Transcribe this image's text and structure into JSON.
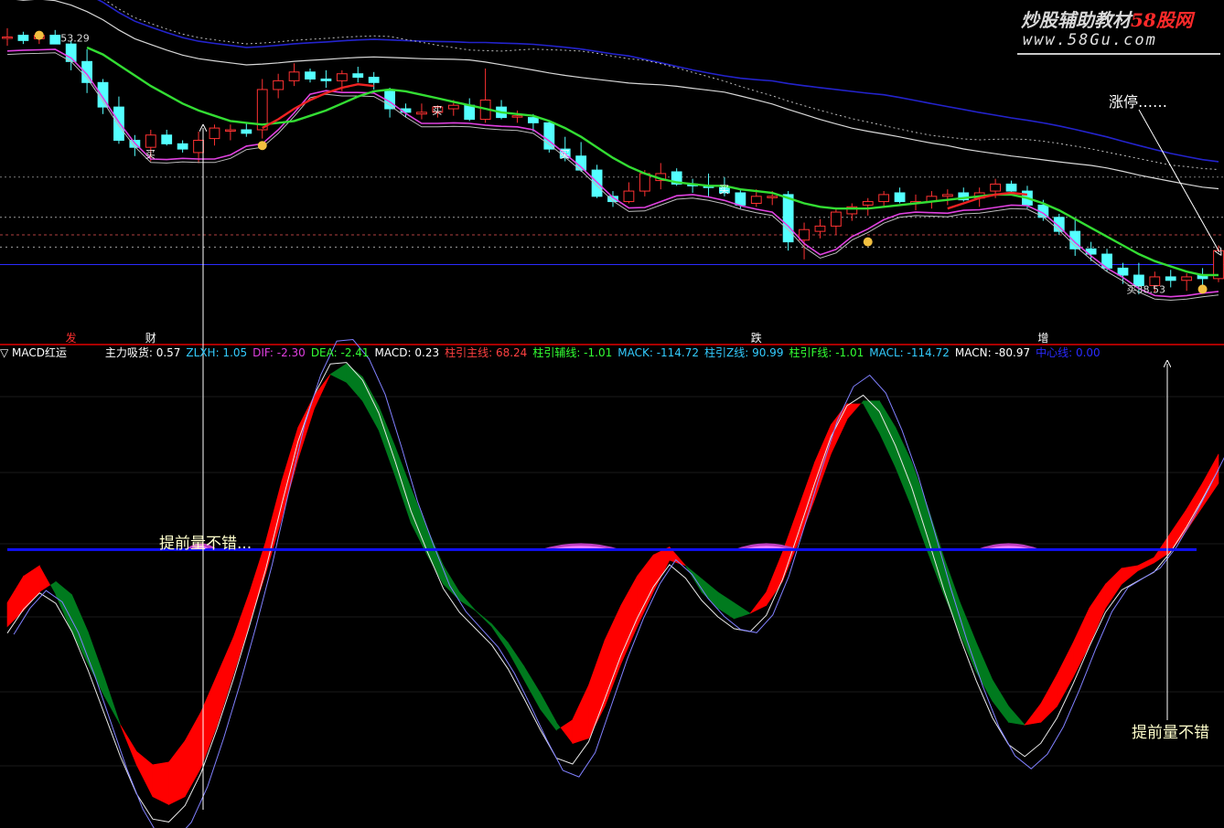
{
  "watermark": {
    "line1_a": "炒股辅助教材",
    "line1_b": "58股网",
    "line2": "www.58Gu.com"
  },
  "price_panel": {
    "high_label": "53.29",
    "low_label": "38.53",
    "buy_mark": "买",
    "zhangting_note": "涨停……",
    "bottom_labels": [
      {
        "text": "发",
        "color": "#ff3030"
      },
      {
        "text": "财",
        "color": "#ffffff"
      },
      {
        "text": "跌",
        "color": "#ffffff"
      },
      {
        "text": "增",
        "color": "#ffffff"
      }
    ]
  },
  "indicator_bar": {
    "title": "▽ MACD红运",
    "items": [
      {
        "label": "主力吸货: 0.57",
        "color": "#ffffff"
      },
      {
        "label": "ZLXH: 1.05",
        "color": "#33ccff"
      },
      {
        "label": "DIF: -2.30",
        "color": "#e040e0"
      },
      {
        "label": "DEA: -2.41",
        "color": "#33ff33"
      },
      {
        "label": "MACD: 0.23",
        "color": "#ffffff"
      },
      {
        "label": "柱引主线: 68.24",
        "color": "#ff4040"
      },
      {
        "label": "柱引辅线: -1.01",
        "color": "#33ff33"
      },
      {
        "label": "MACK: -114.72",
        "color": "#33ccff"
      },
      {
        "label": "柱引Z线: 90.99",
        "color": "#33ccff"
      },
      {
        "label": "柱引F线: -1.01",
        "color": "#33ff33"
      },
      {
        "label": "MACL: -114.72",
        "color": "#33ccff"
      },
      {
        "label": "MACN: -80.97",
        "color": "#ffffff"
      },
      {
        "label": "中心线: 0.00",
        "color": "#2a2aff"
      }
    ]
  },
  "annotations": {
    "left_note": "提前量不错...",
    "right_note": "提前量不错"
  },
  "colors": {
    "up_candle": "#ff3232",
    "down_candle": "#54ffff",
    "ma_green": "#33dd33",
    "ma_red": "#ee2222",
    "ma_magenta": "#e040e0",
    "ma_blue": "#2222dd",
    "band_red": "#ff0000",
    "band_green": "#007a1e",
    "zero_line": "#1010ff",
    "note": "#ffffcc"
  },
  "chart_data": [
    {
      "type": "candlestick",
      "title": "",
      "ylim": [
        36,
        55
      ],
      "y_labels_shown": [
        53.29,
        38.53
      ],
      "candles": [
        {
          "o": 53.2,
          "h": 53.7,
          "l": 52.7,
          "c": 53.2
        },
        {
          "o": 53.3,
          "h": 53.5,
          "l": 52.8,
          "c": 53.0
        },
        {
          "o": 53.1,
          "h": 53.3,
          "l": 52.8,
          "c": 53.3
        },
        {
          "o": 53.3,
          "h": 53.6,
          "l": 52.8,
          "c": 52.8
        },
        {
          "o": 52.8,
          "h": 53.0,
          "l": 51.3,
          "c": 51.8
        },
        {
          "o": 51.8,
          "h": 52.5,
          "l": 50.0,
          "c": 50.6
        },
        {
          "o": 50.6,
          "h": 50.8,
          "l": 48.8,
          "c": 49.2
        },
        {
          "o": 49.2,
          "h": 49.8,
          "l": 47.1,
          "c": 47.3
        },
        {
          "o": 47.3,
          "h": 47.6,
          "l": 46.4,
          "c": 46.9
        },
        {
          "o": 46.9,
          "h": 47.9,
          "l": 46.1,
          "c": 47.6
        },
        {
          "o": 47.6,
          "h": 47.9,
          "l": 47.0,
          "c": 47.1
        },
        {
          "o": 47.1,
          "h": 47.3,
          "l": 46.6,
          "c": 46.8
        },
        {
          "o": 46.6,
          "h": 47.8,
          "l": 46.0,
          "c": 47.3
        },
        {
          "o": 47.4,
          "h": 48.2,
          "l": 47.0,
          "c": 48.0
        },
        {
          "o": 47.9,
          "h": 48.2,
          "l": 47.3,
          "c": 47.9
        },
        {
          "o": 47.9,
          "h": 48.3,
          "l": 47.5,
          "c": 47.7
        },
        {
          "o": 47.9,
          "h": 50.8,
          "l": 47.4,
          "c": 50.2
        },
        {
          "o": 50.2,
          "h": 51.1,
          "l": 49.7,
          "c": 50.7
        },
        {
          "o": 50.7,
          "h": 51.7,
          "l": 50.4,
          "c": 51.2
        },
        {
          "o": 51.2,
          "h": 51.4,
          "l": 50.6,
          "c": 50.8
        },
        {
          "o": 50.8,
          "h": 51.3,
          "l": 50.3,
          "c": 50.7
        },
        {
          "o": 50.7,
          "h": 51.3,
          "l": 50.1,
          "c": 51.1
        },
        {
          "o": 51.1,
          "h": 51.5,
          "l": 50.6,
          "c": 50.9
        },
        {
          "o": 50.9,
          "h": 51.2,
          "l": 50.2,
          "c": 50.6
        },
        {
          "o": 50.1,
          "h": 50.3,
          "l": 48.6,
          "c": 49.1
        },
        {
          "o": 49.1,
          "h": 49.4,
          "l": 48.6,
          "c": 48.9
        },
        {
          "o": 48.8,
          "h": 49.4,
          "l": 48.5,
          "c": 48.9
        },
        {
          "o": 48.9,
          "h": 49.3,
          "l": 48.6,
          "c": 49.2
        },
        {
          "o": 49.1,
          "h": 49.6,
          "l": 48.7,
          "c": 49.3
        },
        {
          "o": 49.3,
          "h": 49.7,
          "l": 48.4,
          "c": 48.5
        },
        {
          "o": 48.5,
          "h": 51.4,
          "l": 48.3,
          "c": 49.6
        },
        {
          "o": 49.2,
          "h": 49.6,
          "l": 48.5,
          "c": 48.6
        },
        {
          "o": 48.7,
          "h": 49.0,
          "l": 48.3,
          "c": 48.7
        },
        {
          "o": 48.6,
          "h": 48.8,
          "l": 47.8,
          "c": 48.3
        },
        {
          "o": 48.3,
          "h": 48.4,
          "l": 46.6,
          "c": 46.8
        },
        {
          "o": 46.8,
          "h": 47.5,
          "l": 46.1,
          "c": 46.3
        },
        {
          "o": 46.4,
          "h": 47.2,
          "l": 45.5,
          "c": 45.6
        },
        {
          "o": 45.6,
          "h": 45.9,
          "l": 44.0,
          "c": 44.1
        },
        {
          "o": 44.1,
          "h": 44.4,
          "l": 43.5,
          "c": 43.8
        },
        {
          "o": 43.8,
          "h": 44.9,
          "l": 43.7,
          "c": 44.4
        },
        {
          "o": 44.4,
          "h": 45.6,
          "l": 44.1,
          "c": 45.4
        },
        {
          "o": 45.0,
          "h": 46.0,
          "l": 44.5,
          "c": 45.4
        },
        {
          "o": 45.5,
          "h": 45.7,
          "l": 44.7,
          "c": 44.8
        },
        {
          "o": 44.8,
          "h": 45.1,
          "l": 44.3,
          "c": 44.7
        },
        {
          "o": 44.7,
          "h": 45.4,
          "l": 44.1,
          "c": 44.6
        },
        {
          "o": 44.6,
          "h": 45.2,
          "l": 44.1,
          "c": 44.3
        },
        {
          "o": 44.3,
          "h": 44.5,
          "l": 43.4,
          "c": 43.6
        },
        {
          "o": 43.7,
          "h": 44.5,
          "l": 43.5,
          "c": 44.1
        },
        {
          "o": 44.1,
          "h": 44.4,
          "l": 43.6,
          "c": 44.1
        },
        {
          "o": 44.2,
          "h": 44.4,
          "l": 41.0,
          "c": 41.5
        },
        {
          "o": 41.6,
          "h": 42.6,
          "l": 40.5,
          "c": 42.2
        },
        {
          "o": 42.1,
          "h": 42.8,
          "l": 41.7,
          "c": 42.4
        },
        {
          "o": 42.4,
          "h": 43.4,
          "l": 41.9,
          "c": 43.2
        },
        {
          "o": 43.1,
          "h": 43.7,
          "l": 42.7,
          "c": 43.5
        },
        {
          "o": 43.6,
          "h": 44.0,
          "l": 43.0,
          "c": 43.8
        },
        {
          "o": 43.8,
          "h": 44.4,
          "l": 43.5,
          "c": 44.2
        },
        {
          "o": 44.3,
          "h": 44.6,
          "l": 43.7,
          "c": 43.8
        },
        {
          "o": 43.7,
          "h": 44.2,
          "l": 43.3,
          "c": 43.8
        },
        {
          "o": 43.8,
          "h": 44.4,
          "l": 43.4,
          "c": 44.1
        },
        {
          "o": 44.1,
          "h": 44.5,
          "l": 43.6,
          "c": 44.2
        },
        {
          "o": 44.3,
          "h": 44.6,
          "l": 43.8,
          "c": 43.9
        },
        {
          "o": 44.0,
          "h": 44.6,
          "l": 43.5,
          "c": 44.3
        },
        {
          "o": 44.4,
          "h": 45.1,
          "l": 44.0,
          "c": 44.8
        },
        {
          "o": 44.8,
          "h": 45.0,
          "l": 44.2,
          "c": 44.4
        },
        {
          "o": 44.4,
          "h": 44.7,
          "l": 43.4,
          "c": 43.6
        },
        {
          "o": 43.6,
          "h": 43.9,
          "l": 42.7,
          "c": 42.9
        },
        {
          "o": 42.9,
          "h": 43.1,
          "l": 41.9,
          "c": 42.1
        },
        {
          "o": 42.1,
          "h": 42.8,
          "l": 40.7,
          "c": 41.1
        },
        {
          "o": 41.1,
          "h": 41.5,
          "l": 40.4,
          "c": 40.8
        },
        {
          "o": 40.8,
          "h": 41.1,
          "l": 39.8,
          "c": 40.0
        },
        {
          "o": 40.0,
          "h": 40.3,
          "l": 39.1,
          "c": 39.6
        },
        {
          "o": 39.6,
          "h": 40.3,
          "l": 38.5,
          "c": 39.0
        },
        {
          "o": 39.0,
          "h": 39.8,
          "l": 38.6,
          "c": 39.5
        },
        {
          "o": 39.5,
          "h": 39.9,
          "l": 38.9,
          "c": 39.3
        },
        {
          "o": 39.3,
          "h": 39.7,
          "l": 38.7,
          "c": 39.5
        },
        {
          "o": 39.6,
          "h": 40.0,
          "l": 39.0,
          "c": 39.4
        },
        {
          "o": 39.4,
          "h": 41.3,
          "l": 39.2,
          "c": 41.0
        }
      ],
      "ma_green": [
        null,
        null,
        null,
        null,
        null,
        52.6,
        52.2,
        51.6,
        51.0,
        50.4,
        49.9,
        49.4,
        49.0,
        48.7,
        48.4,
        48.3,
        48.2,
        48.3,
        48.4,
        48.7,
        49.0,
        49.4,
        49.8,
        50.1,
        50.2,
        50.1,
        49.9,
        49.7,
        49.5,
        49.3,
        49.1,
        48.9,
        48.8,
        48.7,
        48.4,
        48.0,
        47.5,
        46.9,
        46.3,
        45.8,
        45.4,
        45.1,
        44.9,
        44.8,
        44.7,
        44.7,
        44.5,
        44.4,
        44.3,
        44.0,
        43.7,
        43.5,
        43.4,
        43.4,
        43.4,
        43.5,
        43.6,
        43.7,
        43.8,
        43.9,
        44.0,
        44.1,
        44.2,
        44.2,
        44.0,
        43.7,
        43.3,
        42.8,
        42.3,
        41.8,
        41.3,
        40.8,
        40.4,
        40.1,
        39.8,
        39.6,
        39.6
      ],
      "ma_red_segment": {
        "from_index": 16,
        "to_index": 23,
        "values": [
          48.0,
          48.5,
          49.1,
          49.6,
          50.0,
          50.3,
          50.5,
          50.4
        ]
      },
      "ma_red_segment2": {
        "from_index": 59,
        "to_index": 64,
        "values": [
          43.4,
          43.7,
          44.0,
          44.2,
          44.3,
          44.2
        ]
      }
    },
    {
      "type": "area",
      "title": "MACD红运",
      "ylim": [
        -10,
        7
      ],
      "zero_line": 0,
      "x_count": 76,
      "series": [
        {
          "name": "柱引主线",
          "values": [
            -2.0,
            -1.0,
            -0.6,
            -1.7,
            -3.1,
            -4.3,
            -5.5,
            -6.6,
            -7.6,
            -8.1,
            -8.0,
            -7.2,
            -6.1,
            -4.7,
            -3.3,
            -1.6,
            0.3,
            2.6,
            4.6,
            5.8,
            6.6,
            6.3,
            5.6,
            4.5,
            2.8,
            1.0,
            -0.2,
            -1.3,
            -1.9,
            -2.3,
            -2.9,
            -3.8,
            -4.9,
            -6.0,
            -6.8,
            -6.4,
            -5.1,
            -3.4,
            -2.1,
            -1.0,
            -0.2,
            0.1,
            -0.6,
            -1.6,
            -2.2,
            -2.6,
            -2.4,
            -1.6,
            -0.1,
            1.6,
            3.3,
            4.7,
            5.5,
            5.5,
            4.4,
            3.1,
            1.6,
            -0.1,
            -1.7,
            -3.2,
            -4.6,
            -5.7,
            -6.5,
            -6.6,
            -5.8,
            -4.7,
            -3.5,
            -2.2,
            -1.3,
            -0.7,
            -0.6,
            -0.3,
            0.6,
            1.5,
            2.5,
            3.6
          ]
        },
        {
          "name": "柱引辅线",
          "values": [
            -2.9,
            -2.3,
            -1.6,
            -1.2,
            -1.7,
            -3.1,
            -4.8,
            -6.6,
            -8.1,
            -9.3,
            -9.6,
            -9.3,
            -8.2,
            -6.6,
            -4.7,
            -2.8,
            -0.9,
            1.2,
            3.4,
            5.3,
            6.6,
            7.0,
            6.5,
            5.4,
            3.9,
            2.3,
            0.8,
            -0.6,
            -1.6,
            -2.3,
            -2.8,
            -3.5,
            -4.4,
            -5.4,
            -6.5,
            -7.3,
            -7.1,
            -5.9,
            -4.3,
            -2.9,
            -1.6,
            -0.4,
            -0.6,
            -1.1,
            -1.6,
            -2.0,
            -2.4,
            -2.1,
            -1.2,
            0.3,
            1.9,
            3.6,
            4.9,
            5.6,
            5.6,
            4.6,
            3.3,
            1.6,
            -0.3,
            -2.0,
            -3.5,
            -4.9,
            -5.9,
            -6.6,
            -6.5,
            -5.9,
            -4.8,
            -3.6,
            -2.2,
            -1.3,
            -0.8,
            -0.5,
            -0.1,
            0.7,
            1.6,
            2.5
          ]
        }
      ],
      "band_fill": {
        "red_when": "柱引主线 above 柱引辅线",
        "green_when": "柱引主线 below 柱引辅线"
      },
      "bumps_on_zero": [
        [
          11,
          13
        ],
        [
          33,
          38
        ],
        [
          45,
          49
        ],
        [
          60,
          64
        ]
      ]
    }
  ]
}
